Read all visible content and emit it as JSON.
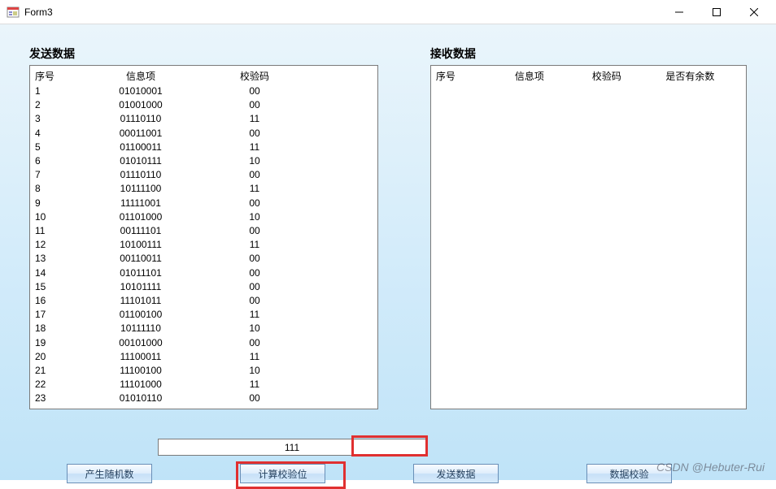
{
  "window": {
    "title": "Form3"
  },
  "panels": {
    "send": {
      "label": "发送数据",
      "headers": {
        "seq": "序号",
        "info": "信息项",
        "check": "校验码"
      },
      "rows": [
        {
          "seq": "1",
          "info": "01010001",
          "check": "00"
        },
        {
          "seq": "2",
          "info": "01001000",
          "check": "00"
        },
        {
          "seq": "3",
          "info": "01110110",
          "check": "11"
        },
        {
          "seq": "4",
          "info": "00011001",
          "check": "00"
        },
        {
          "seq": "5",
          "info": "01100011",
          "check": "11"
        },
        {
          "seq": "6",
          "info": "01010111",
          "check": "10"
        },
        {
          "seq": "7",
          "info": "01110110",
          "check": "00"
        },
        {
          "seq": "8",
          "info": "10111100",
          "check": "11"
        },
        {
          "seq": "9",
          "info": "11111001",
          "check": "00"
        },
        {
          "seq": "10",
          "info": "01101000",
          "check": "10"
        },
        {
          "seq": "11",
          "info": "00111101",
          "check": "00"
        },
        {
          "seq": "12",
          "info": "10100111",
          "check": "11"
        },
        {
          "seq": "13",
          "info": "00110011",
          "check": "00"
        },
        {
          "seq": "14",
          "info": "01011101",
          "check": "00"
        },
        {
          "seq": "15",
          "info": "10101111",
          "check": "00"
        },
        {
          "seq": "16",
          "info": "11101011",
          "check": "00"
        },
        {
          "seq": "17",
          "info": "01100100",
          "check": "11"
        },
        {
          "seq": "18",
          "info": "10111110",
          "check": "10"
        },
        {
          "seq": "19",
          "info": "00101000",
          "check": "00"
        },
        {
          "seq": "20",
          "info": "11100011",
          "check": "11"
        },
        {
          "seq": "21",
          "info": "11100100",
          "check": "10"
        },
        {
          "seq": "22",
          "info": "11101000",
          "check": "11"
        },
        {
          "seq": "23",
          "info": "01010110",
          "check": "00"
        }
      ]
    },
    "recv": {
      "label": "接收数据",
      "headers": {
        "seq": "序号",
        "info": "信息项",
        "check": "校验码",
        "remain": "是否有余数"
      },
      "rows": []
    }
  },
  "textbox": {
    "value": "111"
  },
  "buttons": {
    "gen": "产生随机数",
    "calc": "计算校验位",
    "send": "发送数据",
    "verify": "数据校验"
  },
  "watermark": "CSDN @Hebuter-Rui"
}
